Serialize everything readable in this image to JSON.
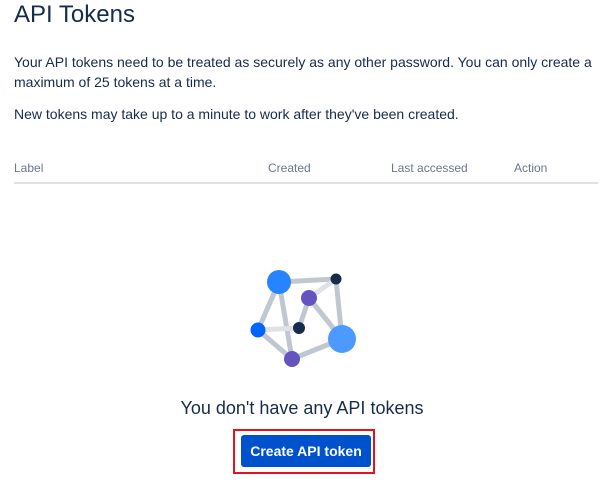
{
  "page": {
    "title": "API Tokens",
    "description_1": "Your API tokens need to be treated as securely as any other password. You can only create a maximum of 25 tokens at a time.",
    "description_2": "New tokens may take up to a minute to work after they've been created."
  },
  "table": {
    "columns": [
      "Label",
      "Created",
      "Last accessed",
      "Action"
    ]
  },
  "empty_state": {
    "illustration_icon": "network-graph-icon",
    "message": "You don't have any API tokens",
    "button_label": "Create API token"
  },
  "colors": {
    "primary_button": "#0052cc",
    "highlight": "#e3121d",
    "text": "#172b4d",
    "muted_text": "#6b778c"
  }
}
